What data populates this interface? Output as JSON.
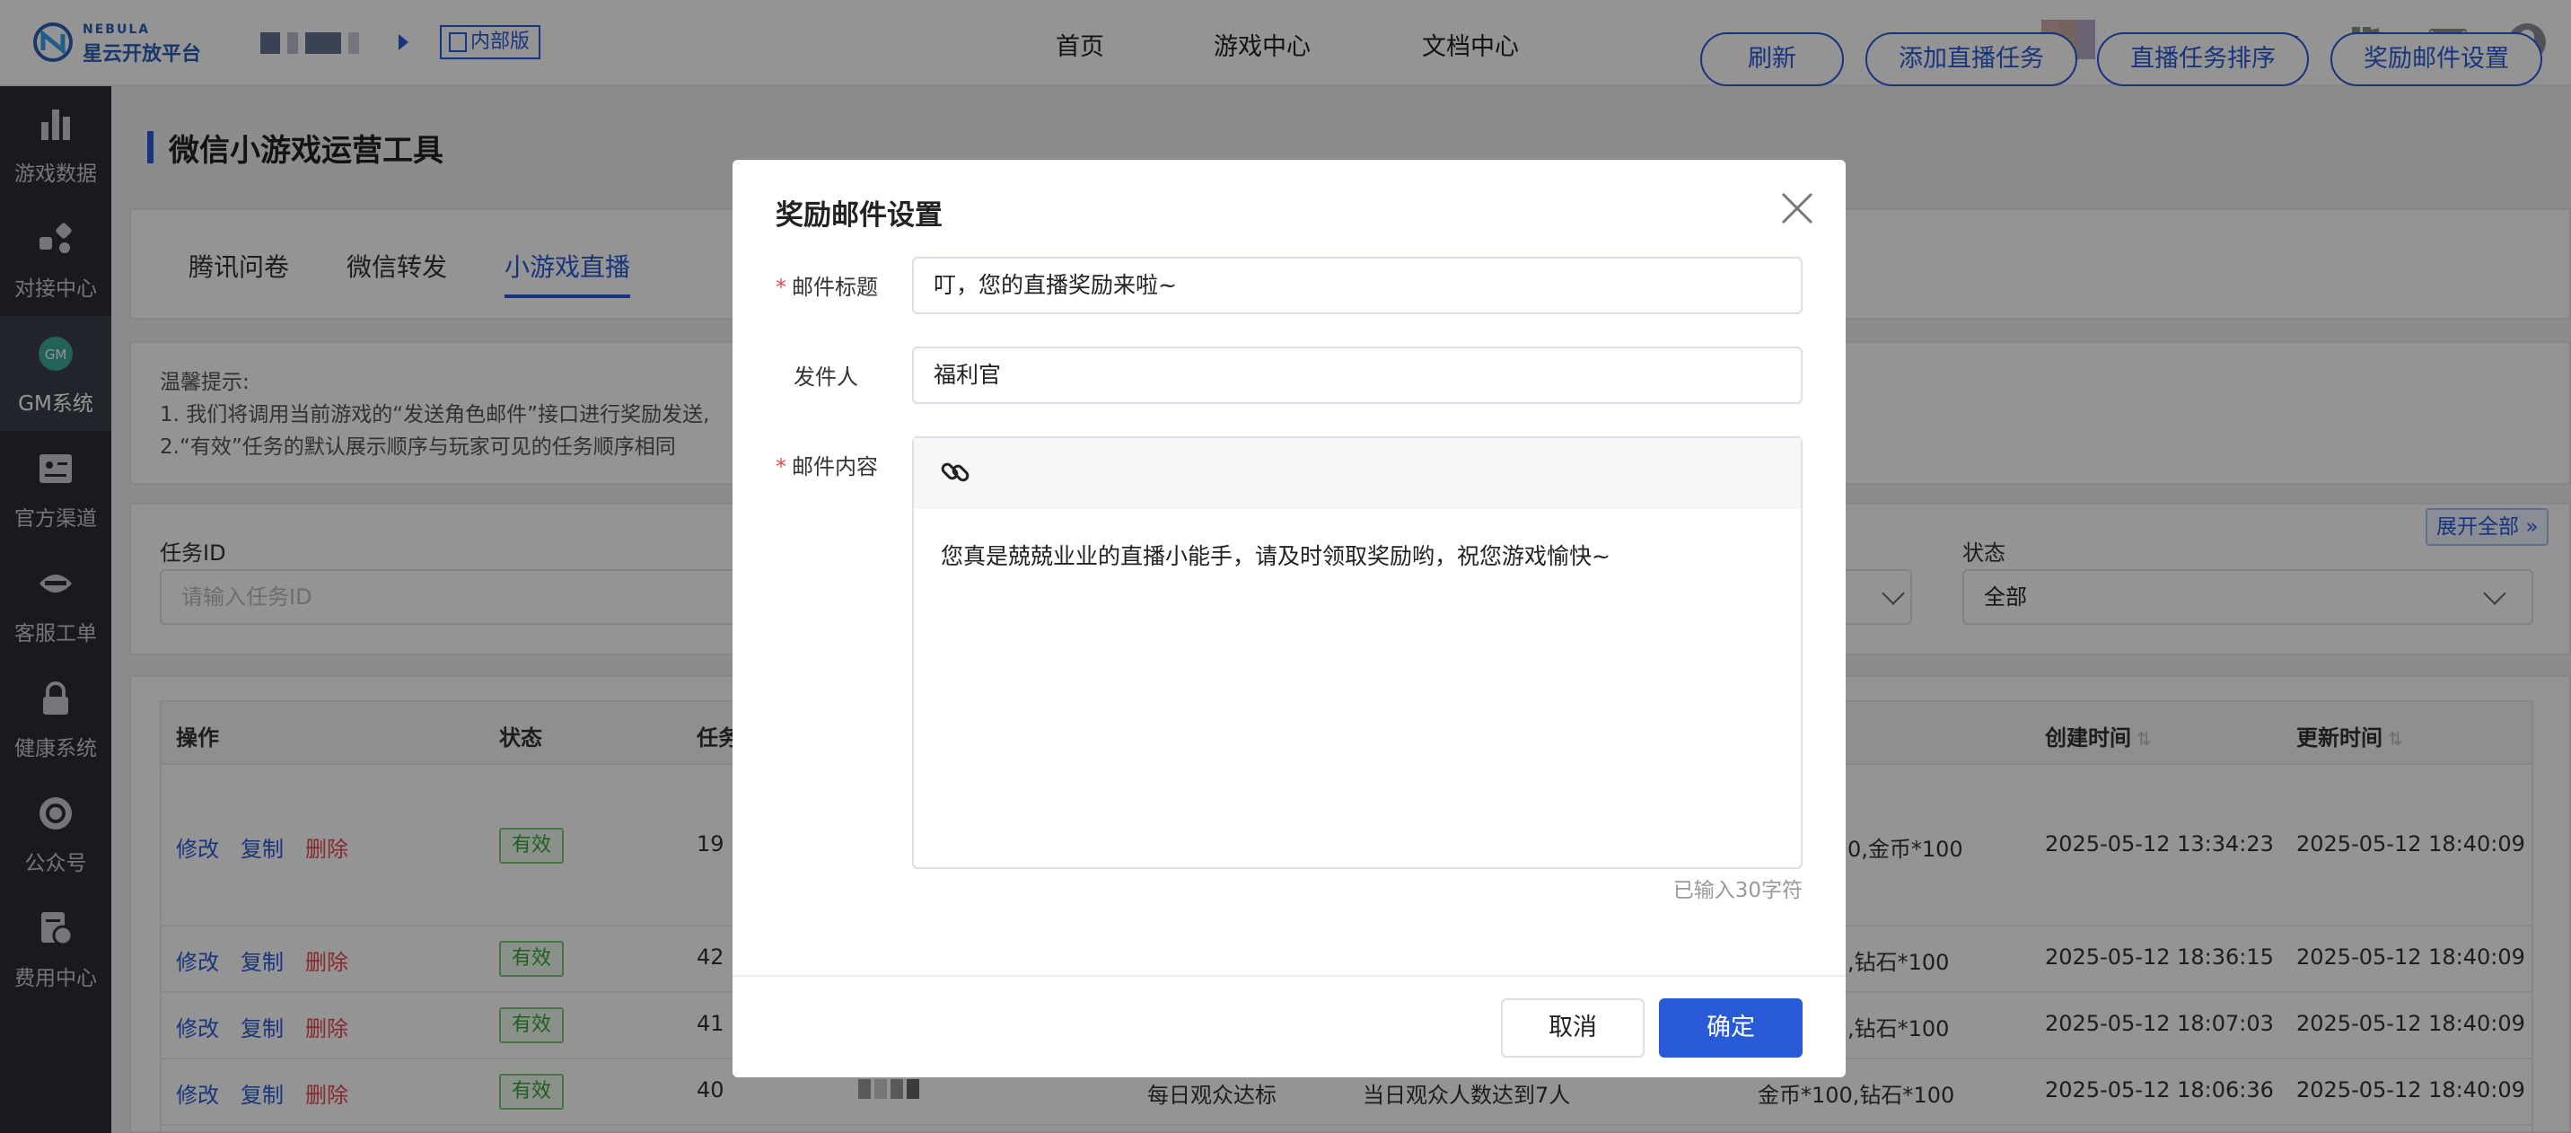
{
  "brand": {
    "name_en": "NEBULA",
    "name_cn": "星云开放平台"
  },
  "header": {
    "internal_badge": "内部版",
    "nav": [
      "首页",
      "游戏中心",
      "文档中心"
    ]
  },
  "sidebar": {
    "items": [
      {
        "label": "游戏数据",
        "icon": "bar-chart-icon"
      },
      {
        "label": "对接中心",
        "icon": "connect-icon"
      },
      {
        "label": "GM系统",
        "icon": "gm-icon",
        "active": true
      },
      {
        "label": "官方渠道",
        "icon": "id-card-icon"
      },
      {
        "label": "客服工单",
        "icon": "customer-service-icon"
      },
      {
        "label": "健康系统",
        "icon": "lock-icon"
      },
      {
        "label": "公众号",
        "icon": "wechat-account-icon"
      },
      {
        "label": "费用中心",
        "icon": "billing-icon"
      }
    ]
  },
  "page": {
    "title": "微信小游戏运营工具",
    "buttons": [
      "刷新",
      "添加直播任务",
      "直播任务排序",
      "奖励邮件设置"
    ],
    "tabs": [
      "腾讯问卷",
      "微信转发",
      "小游戏直播"
    ],
    "active_tab": "小游戏直播",
    "tips": {
      "heading": "温馨提示:",
      "line1": "1. 我们将调用当前游戏的“发送角色邮件”接口进行奖励发送,",
      "line2": "2.“有效”任务的默认展示顺序与玩家可见的任务顺序相同"
    },
    "filters": {
      "task_id_label": "任务ID",
      "task_id_placeholder": "请输入任务ID",
      "status_label": "状态",
      "status_value": "全部",
      "expand_label": "展开全部"
    }
  },
  "table": {
    "headers": {
      "op": "操作",
      "status": "状态",
      "task": "任务",
      "created": "创建时间",
      "updated": "更新时间"
    },
    "actions": {
      "edit": "修改",
      "copy": "复制",
      "delete": "删除"
    },
    "rows": [
      {
        "status": "有效",
        "id": "19",
        "reward": "0,金币*100",
        "created": "2025-05-12 13:34:23",
        "updated": "2025-05-12 18:40:09"
      },
      {
        "status": "有效",
        "id": "42",
        "reward": ",钻石*100",
        "created": "2025-05-12 18:36:15",
        "updated": "2025-05-12 18:40:09"
      },
      {
        "status": "有效",
        "id": "41",
        "reward": ",钻石*100",
        "created": "2025-05-12 18:07:03",
        "updated": "2025-05-12 18:40:09"
      },
      {
        "status": "有效",
        "id": "40",
        "type": "每日观众达标",
        "condition": "当日观众人数达到7人",
        "reward": "金币*100,钻石*100",
        "created": "2025-05-12 18:06:36",
        "updated": "2025-05-12 18:40:09"
      }
    ]
  },
  "modal": {
    "title": "奖励邮件设置",
    "subject_label": "邮件标题",
    "subject_value": "叮，您的直播奖励来啦~",
    "sender_label": "发件人",
    "sender_value": "福利官",
    "content_label": "邮件内容",
    "content_value": "您真是兢兢业业的直播小能手，请及时领取奖励哟，祝您游戏愉快~",
    "char_count": "已输入30字符",
    "cancel": "取消",
    "confirm": "确定"
  },
  "colors": {
    "primary": "#2a5bd7",
    "danger": "#e5484d",
    "success": "#3aa33a",
    "sidebar": "#2a2e36"
  }
}
